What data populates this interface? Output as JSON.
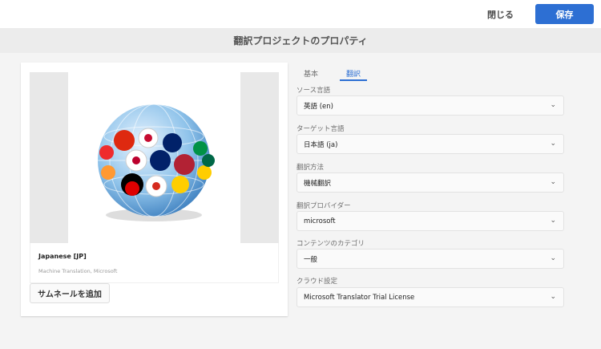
{
  "header": {
    "close_label": "閉じる",
    "save_label": "保存",
    "accent": "#2d6fd3"
  },
  "title": "翻訳プロジェクトのプロパティ",
  "card": {
    "name": "Japanese [JP]",
    "subtitle": "Machine Translation, Microsoft",
    "add_thumbnail": "サムネールを追加"
  },
  "tabs": [
    {
      "label": "基本"
    },
    {
      "label": "翻訳",
      "active": true
    }
  ],
  "fields": [
    {
      "label": "ソース言語",
      "value": "英語 (en)"
    },
    {
      "label": "ターゲット言語",
      "value": "日本語 (ja)"
    },
    {
      "label": "翻訳方法",
      "value": "機械翻訳"
    },
    {
      "label": "翻訳プロバイダー",
      "value": "microsoft"
    },
    {
      "label": "コンテンツのカテゴリ",
      "value": "一般"
    },
    {
      "label": "クラウド設定",
      "value": "Microsoft Translator Trial License"
    }
  ]
}
